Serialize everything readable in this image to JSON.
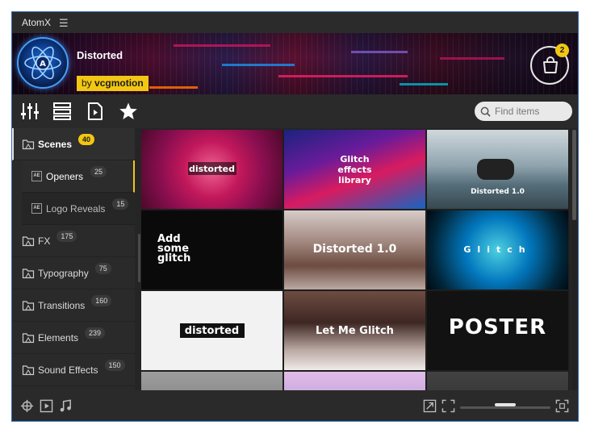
{
  "app": {
    "title": "AtomX"
  },
  "pack": {
    "title": "Distorted",
    "by": "by ",
    "author": "vcgmotion"
  },
  "cart": {
    "count": "2"
  },
  "search": {
    "placeholder": "Find items"
  },
  "sidebar": {
    "categories": [
      {
        "label": "Scenes",
        "count": "40"
      },
      {
        "label": "FX",
        "count": "175"
      },
      {
        "label": "Typography",
        "count": "75"
      },
      {
        "label": "Transitions",
        "count": "160"
      },
      {
        "label": "Elements",
        "count": "239"
      },
      {
        "label": "Sound Effects",
        "count": "150"
      }
    ],
    "subcategories": [
      {
        "label": "Openers",
        "count": "25"
      },
      {
        "label": "Logo Reveals",
        "count": "15"
      }
    ],
    "ae_icon_text": "AE"
  },
  "thumbnails": [
    {
      "title": "distorted"
    },
    {
      "title": "Glitch effects library"
    },
    {
      "title": "Distorted 1.0"
    },
    {
      "title": "Add some glitch"
    },
    {
      "title": "Distorted 1.0"
    },
    {
      "title": "Glitch"
    },
    {
      "title": "distorted"
    },
    {
      "title": "Let Me Glitch"
    },
    {
      "title": "POSTER"
    }
  ],
  "colors": {
    "accent": "#f2c713",
    "window_border": "#2e6db6",
    "logo_glow": "#3fa0ff"
  },
  "icons": {
    "toolbar": [
      "sliders-icon",
      "list-view-icon",
      "video-file-icon",
      "star-icon",
      "search-icon"
    ],
    "bottombar": [
      "crosshair-icon",
      "play-icon",
      "music-icon",
      "export-icon",
      "fit-icon",
      "expand-icon"
    ]
  }
}
